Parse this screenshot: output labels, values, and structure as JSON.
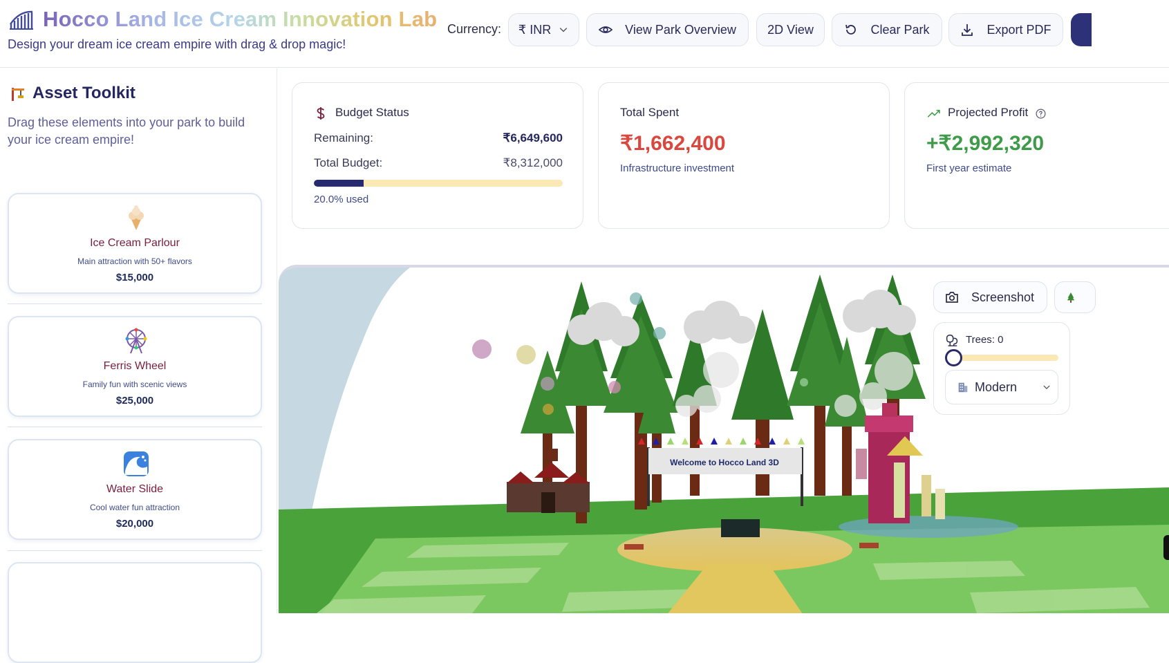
{
  "header": {
    "title": "Hocco Land Ice Cream Innovation Lab",
    "subtitle": "Design your dream ice cream empire with drag & drop magic!",
    "currency_label": "Currency:",
    "currency_value": "₹ INR",
    "view_overview": "View Park Overview",
    "view_2d": "2D View",
    "clear_park": "Clear Park",
    "export_pdf": "Export PDF"
  },
  "sidebar": {
    "title": "Asset Toolkit",
    "description": "Drag these elements into your park to build your ice cream empire!",
    "items": [
      {
        "name": "Ice Cream Parlour",
        "desc": "Main attraction with 50+ flavors",
        "price": "$15,000",
        "icon": "ice-cream-icon"
      },
      {
        "name": "Ferris Wheel",
        "desc": "Family fun with scenic views",
        "price": "$25,000",
        "icon": "ferris-wheel-icon"
      },
      {
        "name": "Water Slide",
        "desc": "Cool water fun attraction",
        "price": "$20,000",
        "icon": "wave-icon"
      }
    ]
  },
  "budget": {
    "title": "Budget Status",
    "remaining_label": "Remaining:",
    "remaining_value": "₹6,649,600",
    "total_label": "Total Budget:",
    "total_value": "₹8,312,000",
    "used_fraction": 0.2,
    "used_text": "20.0% used"
  },
  "spent": {
    "title": "Total Spent",
    "value": "₹1,662,400",
    "caption": "Infrastructure investment",
    "color": "#d9473e"
  },
  "profit": {
    "title": "Projected Profit",
    "value": "+₹2,992,320",
    "caption": "First year estimate",
    "color": "#3f9a49"
  },
  "scene": {
    "banner": "Welcome to Hocco Land 3D",
    "screenshot_label": "Screenshot",
    "trees_label": "Trees: 0",
    "trees_level": 0,
    "style_value": "Modern"
  },
  "colors": {
    "navy": "#282a70",
    "accent_bar": "#fbe8b4",
    "grass": "#6bbf4e",
    "tree": "#2f7a2a"
  }
}
